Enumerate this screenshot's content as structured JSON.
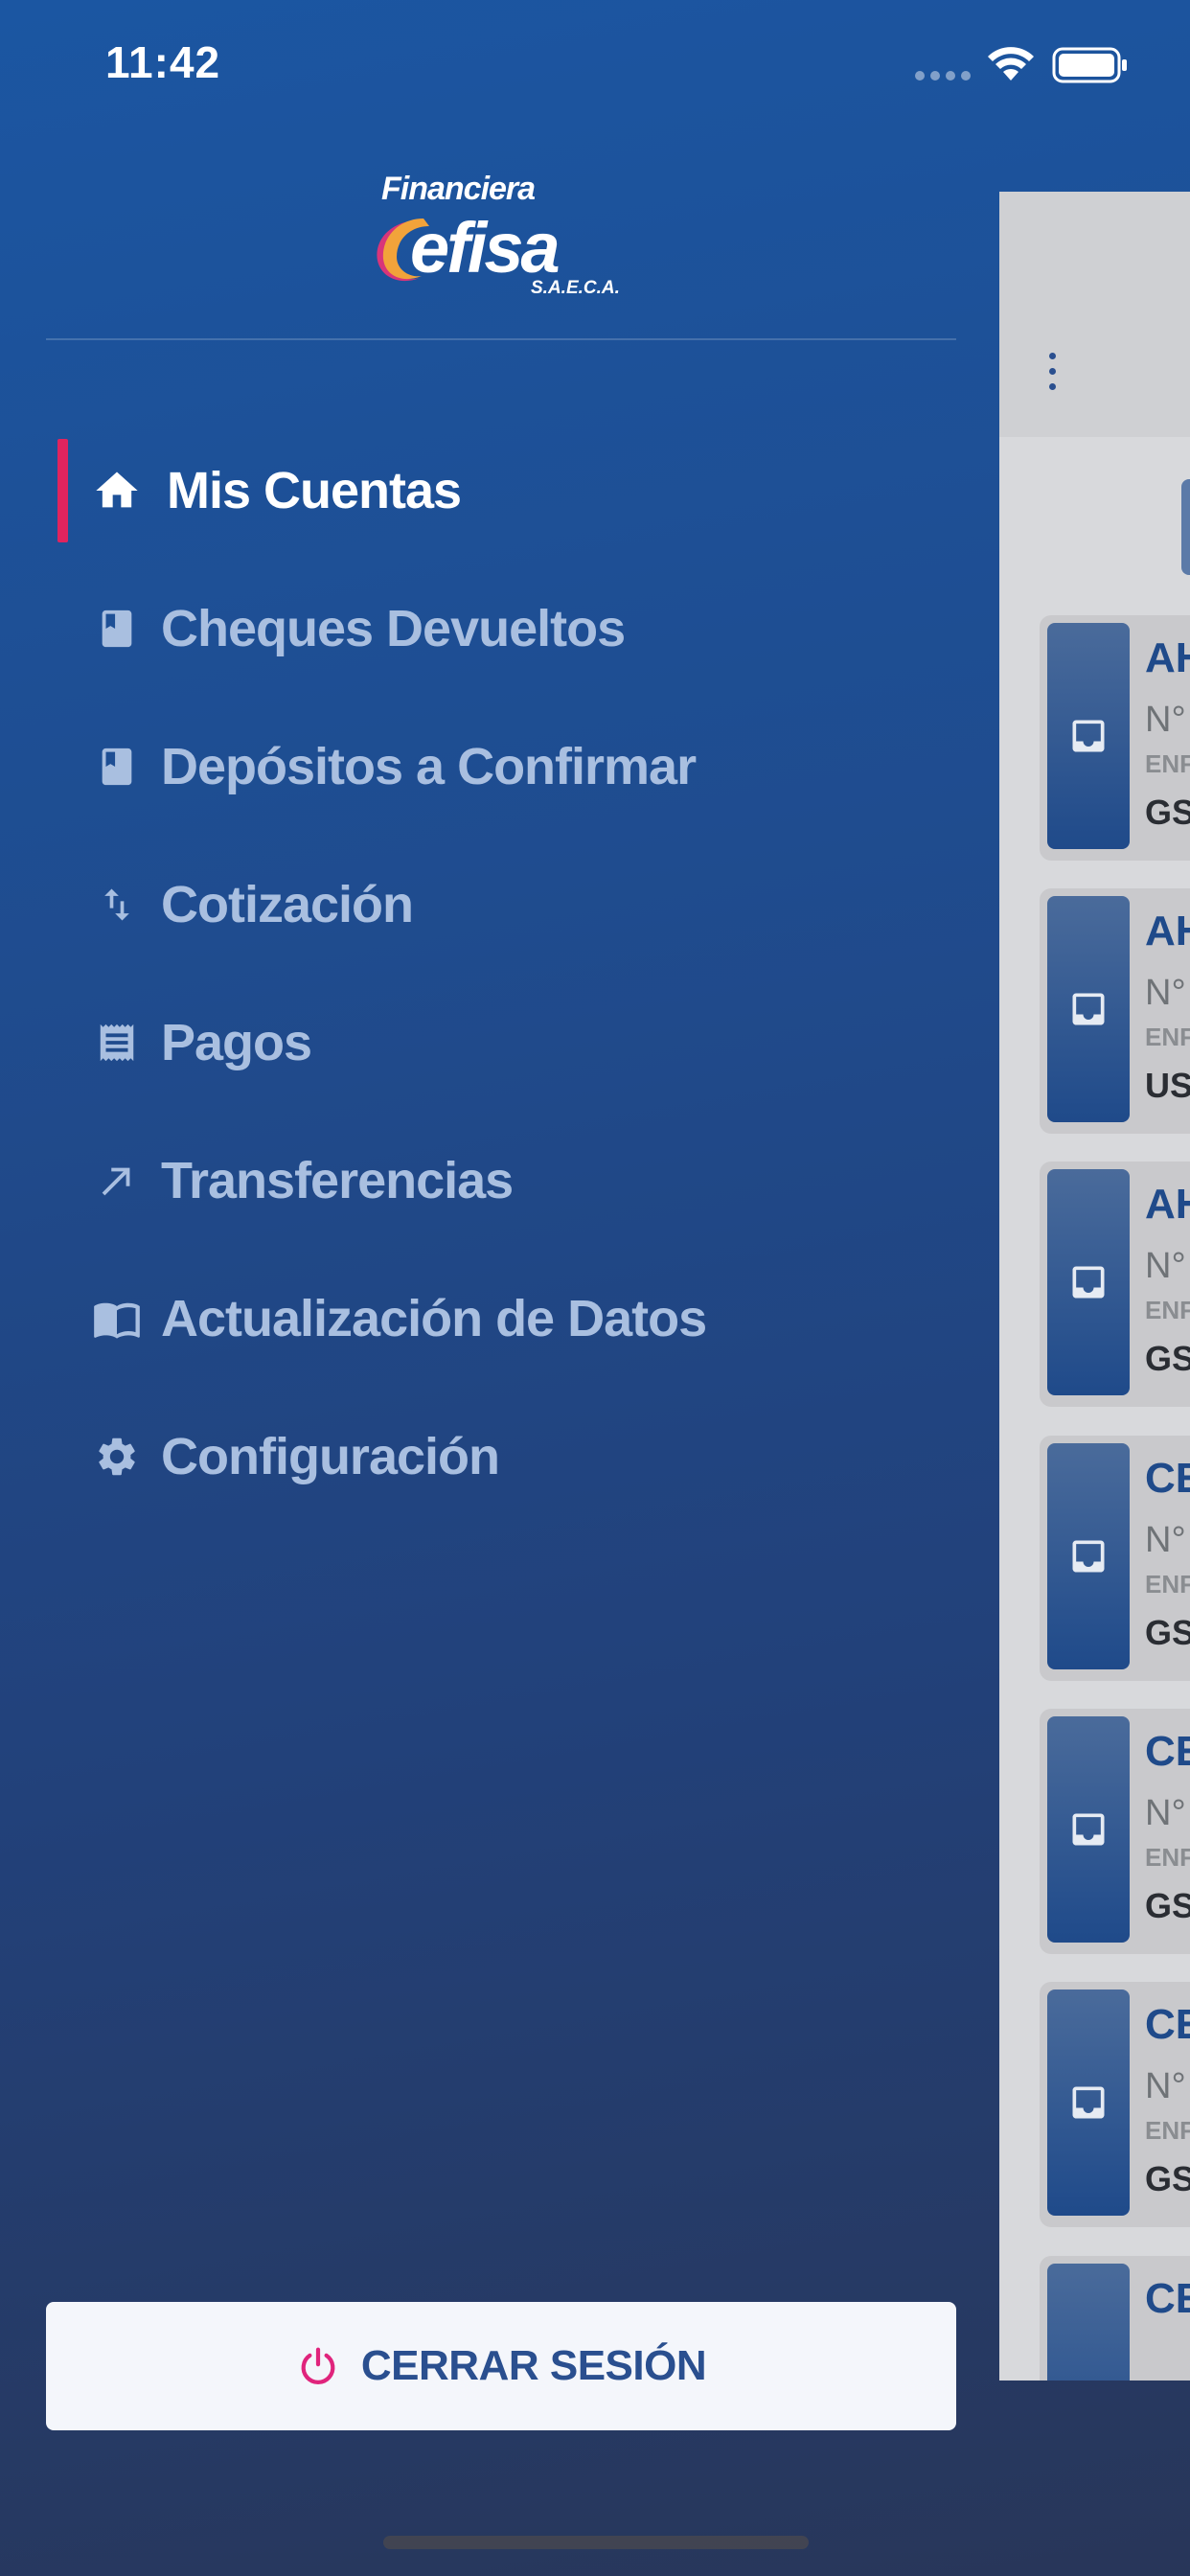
{
  "status_bar": {
    "time": "11:42"
  },
  "brand": {
    "line1": "Financiera",
    "name": "Cefisa",
    "suffix": "S.A.E.C.A."
  },
  "menu": {
    "items": [
      {
        "label": "Mis Cuentas",
        "icon": "home-icon",
        "active": true
      },
      {
        "label": "Cheques Devueltos",
        "icon": "book-icon",
        "active": false
      },
      {
        "label": "Depósitos a Confirmar",
        "icon": "book-icon",
        "active": false
      },
      {
        "label": "Cotización",
        "icon": "swap-vertical-icon",
        "active": false
      },
      {
        "label": "Pagos",
        "icon": "receipt-icon",
        "active": false
      },
      {
        "label": "Transferencias",
        "icon": "arrow-up-right-icon",
        "active": false
      },
      {
        "label": "Actualización de Datos",
        "icon": "open-book-icon",
        "active": false
      },
      {
        "label": "Configuración",
        "icon": "gear-icon",
        "active": false
      }
    ]
  },
  "logout": {
    "label": "CERRAR SESIÓN",
    "icon": "power-icon"
  },
  "background_app": {
    "accounts": [
      {
        "name": "AH",
        "num": "N°",
        "sub": "ENF",
        "cur": "GS"
      },
      {
        "name": "AH",
        "num": "N°",
        "sub": "ENF",
        "cur": "US"
      },
      {
        "name": "AH",
        "num": "N°",
        "sub": "ENF",
        "cur": "GS"
      },
      {
        "name": "CE",
        "num": "N°",
        "sub": "ENF",
        "cur": "GS"
      },
      {
        "name": "CE",
        "num": "N°",
        "sub": "ENF",
        "cur": "GS"
      },
      {
        "name": "CE",
        "num": "N°",
        "sub": "ENF",
        "cur": "GS"
      },
      {
        "name": "CE",
        "num": "",
        "sub": "",
        "cur": ""
      }
    ]
  },
  "colors": {
    "accent": "#e0245e",
    "brand_blue": "#2a4f8f",
    "logo_orange": "#f2a33a",
    "logo_magenta": "#d8357a"
  }
}
